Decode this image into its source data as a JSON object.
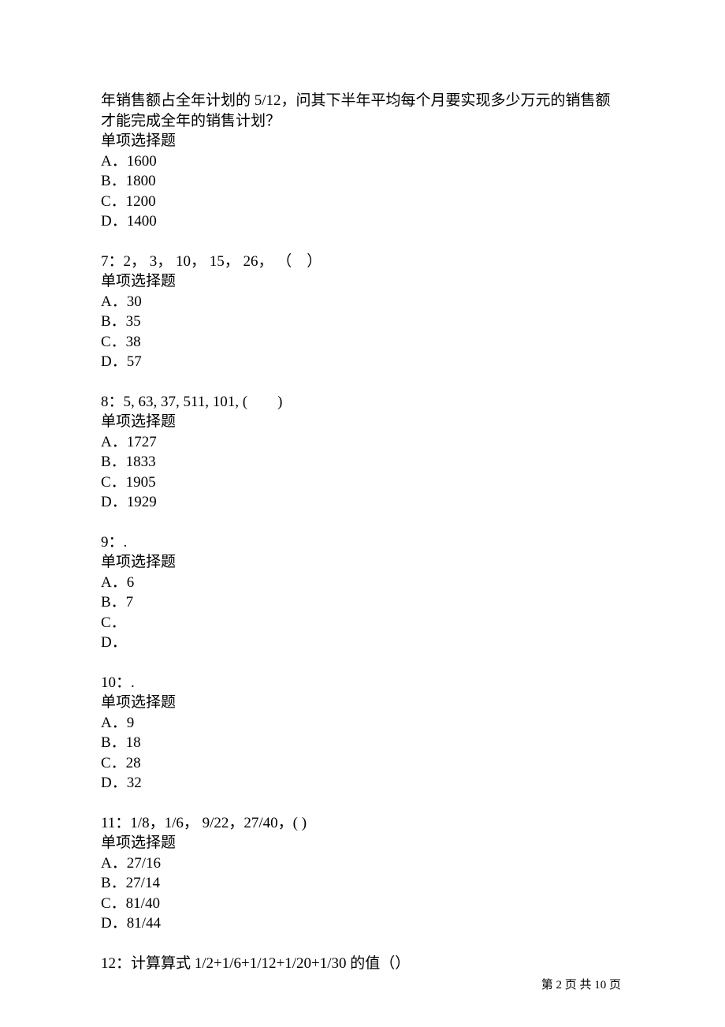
{
  "intro": {
    "line1": "年销售额占全年计划的 5/12，问其下半年平均每个月要实现多少万元的销售额",
    "line2": "才能完成全年的销售计划？",
    "type": "单项选择题"
  },
  "q6": {
    "options": {
      "A": "A．1600",
      "B": "B．1800",
      "C": "C．1200",
      "D": "D．1400"
    }
  },
  "q7": {
    "title": "7：2，  3， 10， 15， 26， （　）",
    "type": "单项选择题",
    "options": {
      "A": "A．30",
      "B": "B．35",
      "C": "C．38",
      "D": "D．57"
    }
  },
  "q8": {
    "title": "8：5, 63, 37, 511, 101, (　　)",
    "type": "单项选择题",
    "options": {
      "A": "A．1727",
      "B": "B．1833",
      "C": "C．1905",
      "D": "D．1929"
    }
  },
  "q9": {
    "title": "9：.",
    "type": "单项选择题",
    "options": {
      "A": "A．6",
      "B": "B．7",
      "C": "C．",
      "D": "D．"
    }
  },
  "q10": {
    "title": "10：.",
    "type": "单项选择题",
    "options": {
      "A": "A．9",
      "B": "B．18",
      "C": "C．28",
      "D": "D．32"
    }
  },
  "q11": {
    "title": "11：1/8，1/6，  9/22，27/40，( )",
    "type": "单项选择题",
    "options": {
      "A": "A．27/16",
      "B": "B．27/14",
      "C": "C．81/40",
      "D": "D．81/44"
    }
  },
  "q12": {
    "title": "12：计算算式 1/2+1/6+1/12+1/20+1/30 的值（）"
  },
  "footer": "第 2 页 共 10 页"
}
